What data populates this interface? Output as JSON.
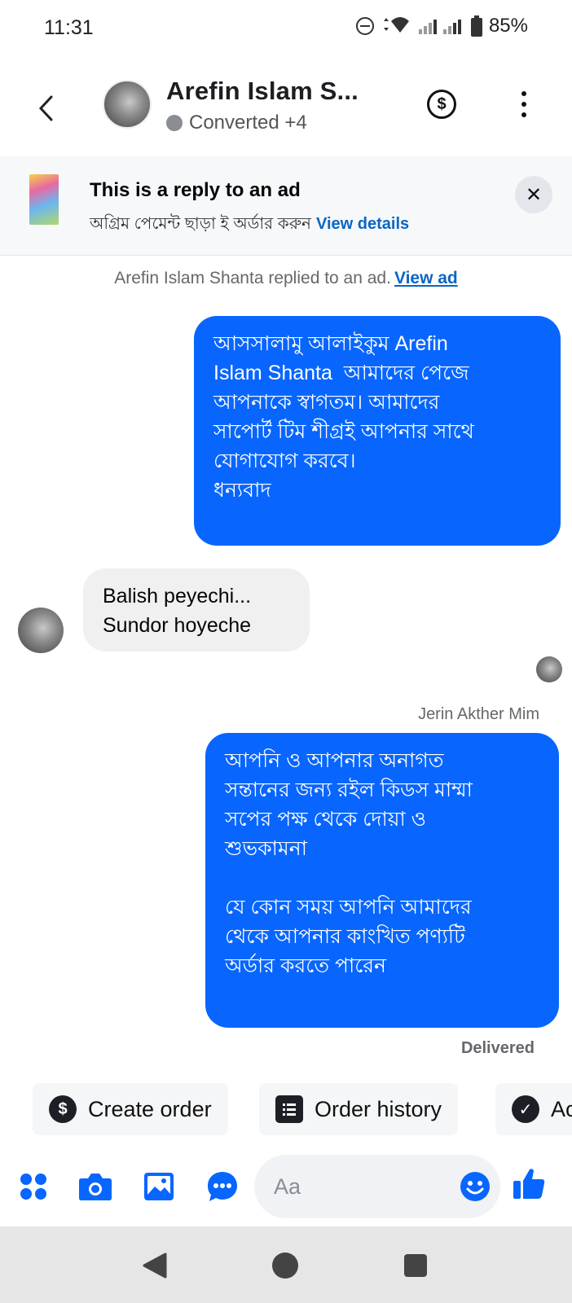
{
  "status_bar": {
    "time": "11:31",
    "battery": "85%"
  },
  "header": {
    "contact_name": "Arefin Islam S...",
    "contact_status": "Converted +4"
  },
  "ad_banner": {
    "title": "This is a reply to an ad",
    "subtitle": "অগ্রিম পেমেন্ট ছাড়া ই অর্ডার করুন",
    "link": "View details"
  },
  "conversation": {
    "system_note": "Arefin Islam Shanta replied to an ad.",
    "system_note_link": "View ad",
    "message_1_lines": [
      "আসসালামু আলাইকুম Arefin",
      "Islam Shanta  আমাদের পেজে",
      "আপনাকে স্বাগতম। আমাদের",
      "সাপোর্ট টিম শীগ্রই আপনার সাথে",
      "যোগাযোগ করবে।",
      "ধন্যবাদ"
    ],
    "message_2_lines": [
      "Balish peyechi...",
      "Sundor hoyeche"
    ],
    "sender_name": "Jerin Akther Mim",
    "message_3_lines": [
      "আপনি ও আপনার অনাগত",
      "সন্তানের জন্য রইল কিডস মাম্মা",
      "সপের পক্ষ থেকে দোয়া ও",
      "শুভকামনা",
      "",
      "যে কোন সময় আপনি আমাদের",
      "থেকে আপনার কাংখিত পণ্যটি",
      "অর্ডার করতে পারেন"
    ],
    "delivered": "Delivered"
  },
  "quick_actions": {
    "create_order": "Create order",
    "order_history": "Order history",
    "third": "Ac"
  },
  "composer": {
    "placeholder": "Aa"
  },
  "colors": {
    "accent": "#0866ff",
    "incoming": "#f0f0f0",
    "link": "#0a66c2"
  }
}
